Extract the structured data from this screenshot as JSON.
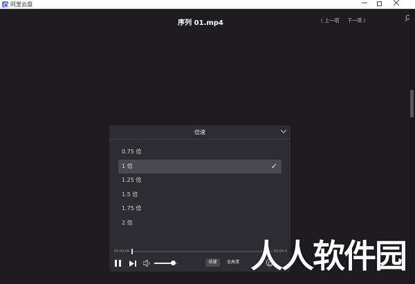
{
  "window": {
    "app_title": "阿里云盘",
    "icons": {
      "app": "cloud-drive-logo-icon",
      "minimize": "minimize-icon",
      "maximize": "maximize-icon",
      "close": "close-icon"
    }
  },
  "player": {
    "title": "序列 01.mp4",
    "prev_label": "〈 上一项",
    "next_label": "下一项 〉",
    "icons": {
      "pin": "pin-icon"
    }
  },
  "speed_panel": {
    "title": "倍速",
    "options": [
      {
        "label": "0.75 倍",
        "selected": false
      },
      {
        "label": "1 倍",
        "selected": true
      },
      {
        "label": "1.25 倍",
        "selected": false
      },
      {
        "label": "1.5 倍",
        "selected": false
      },
      {
        "label": "1.75 倍",
        "selected": false
      },
      {
        "label": "2 倍",
        "selected": false
      }
    ],
    "icons": {
      "collapse": "chevron-down-icon",
      "check": "checkmark-icon"
    }
  },
  "controls": {
    "time_current": "00:00:00",
    "time_total": "00:00:0",
    "progress": 0.0,
    "volume": 0.8,
    "speed_label": "倍速",
    "quality_label": "全高清",
    "icons": {
      "play_pause": "pause-icon",
      "next": "next-track-icon",
      "volume": "speaker-icon",
      "pip": "picture-in-picture-icon"
    }
  },
  "watermark": {
    "text": "人人软件园"
  },
  "colors": {
    "background": "#1e1b21",
    "panel": "#2e2c33",
    "selected_row": "#4b4950",
    "text": "#e6e6e6"
  }
}
